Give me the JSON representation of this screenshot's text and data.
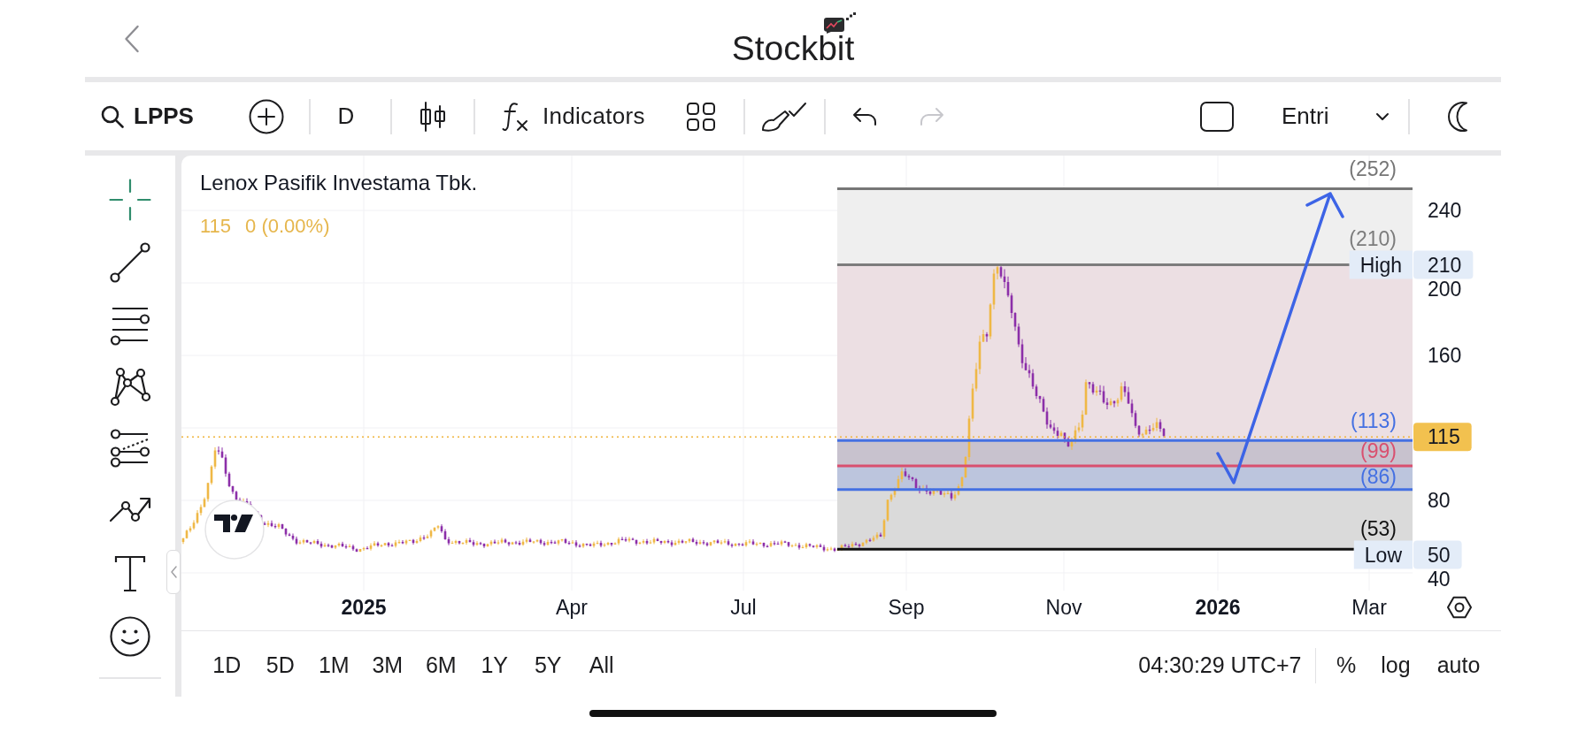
{
  "header": {
    "logo_text": "Stockbit"
  },
  "toolbar": {
    "symbol": "LPPS",
    "interval": "D",
    "indicators_label": "Indicators",
    "undo": {
      "disabled": false
    },
    "redo": {
      "disabled": true
    },
    "template": "Entri"
  },
  "drawing_tools": [
    {
      "kind": "crosshair",
      "selected": true
    },
    {
      "kind": "line",
      "selected": false
    },
    {
      "kind": "levels",
      "selected": false
    },
    {
      "kind": "pattern",
      "selected": false
    },
    {
      "kind": "projection",
      "selected": false
    },
    {
      "kind": "path",
      "selected": false
    },
    {
      "kind": "text",
      "selected": false
    },
    {
      "kind": "emoji",
      "selected": false
    }
  ],
  "chart": {
    "title": "Lenox Pasifik Investama Tbk.",
    "price": "115",
    "change": "0 (0.00%)",
    "price_axis": [
      "240",
      "200",
      "160",
      "80",
      "40"
    ],
    "time_axis": [
      {
        "label": "2025",
        "kind": "year"
      },
      {
        "label": "Apr",
        "kind": "month"
      },
      {
        "label": "Jul",
        "kind": "month"
      },
      {
        "label": "Sep",
        "kind": "month"
      },
      {
        "label": "Nov",
        "kind": "month"
      },
      {
        "label": "2026",
        "kind": "year"
      },
      {
        "label": "Mar",
        "kind": "month"
      }
    ],
    "levels": [
      {
        "label": "(252)",
        "color": "#767676"
      },
      {
        "label": "(210)",
        "color": "#7c7c7c"
      },
      {
        "label": "(113)",
        "color": "#4470e2"
      },
      {
        "label": "(99)",
        "color": "#d9506f"
      },
      {
        "label": "(86)",
        "color": "#4470e2"
      },
      {
        "label": "(53)",
        "color": "#111111"
      }
    ],
    "price_tags": [
      {
        "kind": "high",
        "label": "High",
        "value": "210"
      },
      {
        "kind": "last",
        "value": "115"
      },
      {
        "kind": "low",
        "label": "Low",
        "value": "50"
      }
    ]
  },
  "bottom_bar": {
    "ranges": [
      {
        "label": "1D",
        "selected": false
      },
      {
        "label": "5D",
        "selected": false
      },
      {
        "label": "1M",
        "selected": false
      },
      {
        "label": "3M",
        "selected": false
      },
      {
        "label": "6M",
        "selected": false
      },
      {
        "label": "1Y",
        "selected": false
      },
      {
        "label": "5Y",
        "selected": false
      },
      {
        "label": "All",
        "selected": false
      }
    ],
    "clock": "04:30:29 UTC+7",
    "scale_options": [
      "%",
      "log",
      "auto"
    ]
  }
}
